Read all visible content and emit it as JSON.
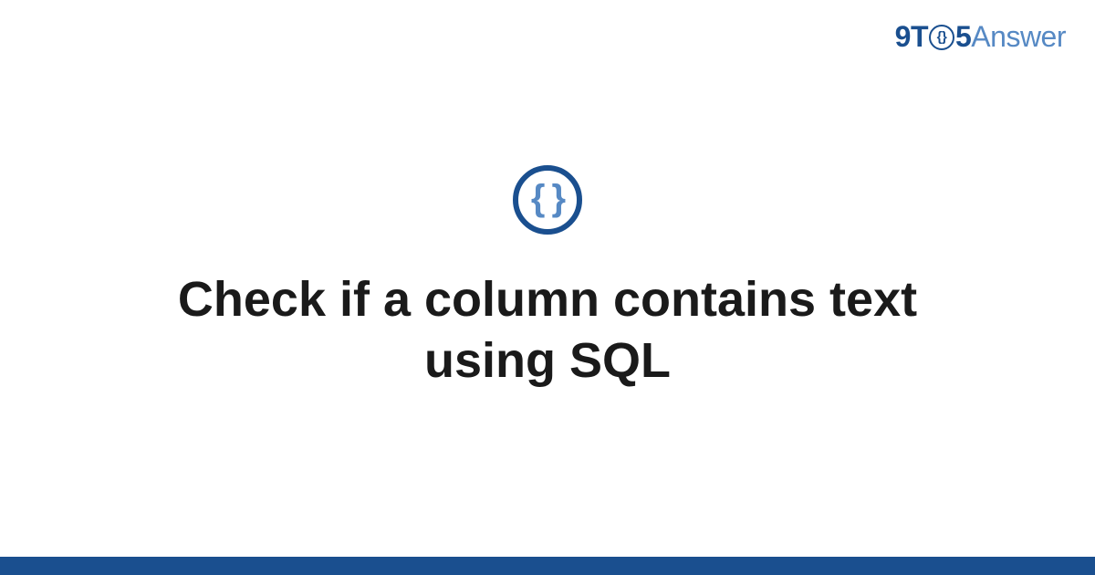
{
  "brand": {
    "part1": "9T",
    "circle_inner": "{}",
    "part2": "5",
    "part3": "Answer"
  },
  "icon": {
    "glyph": "{ }"
  },
  "title": "Check if a column contains text using SQL",
  "colors": {
    "primary": "#1a4f8f",
    "secondary": "#5689c4",
    "text": "#1a1a1a"
  }
}
